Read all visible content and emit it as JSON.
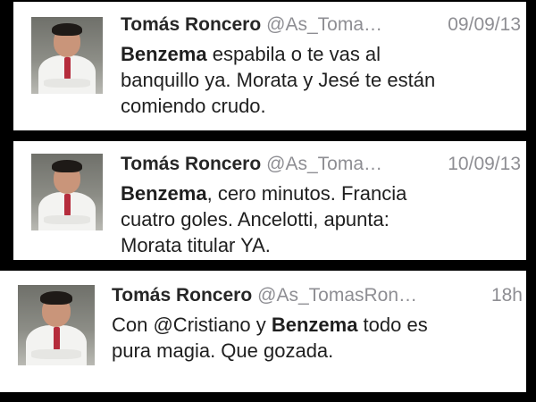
{
  "tweets": [
    {
      "name": "Tomás Roncero",
      "handle": "@As_Toma…",
      "date": "09/09/13",
      "lines": [
        {
          "bold": "Benzema",
          "rest": " espabila o te vas al"
        },
        {
          "text": "banquillo ya. Morata y Jesé te están"
        },
        {
          "text": "comiendo crudo."
        }
      ]
    },
    {
      "name": "Tomás Roncero",
      "handle": "@As_Toma…",
      "date": "10/09/13",
      "lines": [
        {
          "bold": "Benzema",
          "rest": ", cero minutos. Francia"
        },
        {
          "text": "cuatro goles. Ancelotti, apunta:"
        },
        {
          "text": "Morata titular YA."
        }
      ]
    },
    {
      "name": "Tomás Roncero",
      "handle": "@As_TomasRon…",
      "date": "18h",
      "lines": [
        {
          "pre": "Con @Cristiano y ",
          "bold": "Benzema",
          "rest": " todo es"
        },
        {
          "text": "pura magia. Que gozada."
        }
      ]
    }
  ],
  "colors": {
    "background": "#000000",
    "card": "#ffffff",
    "name": "#262626",
    "meta_gray": "#8e8e93",
    "text": "#1f1f1f"
  },
  "icons": {
    "avatar": "profile-photo"
  }
}
